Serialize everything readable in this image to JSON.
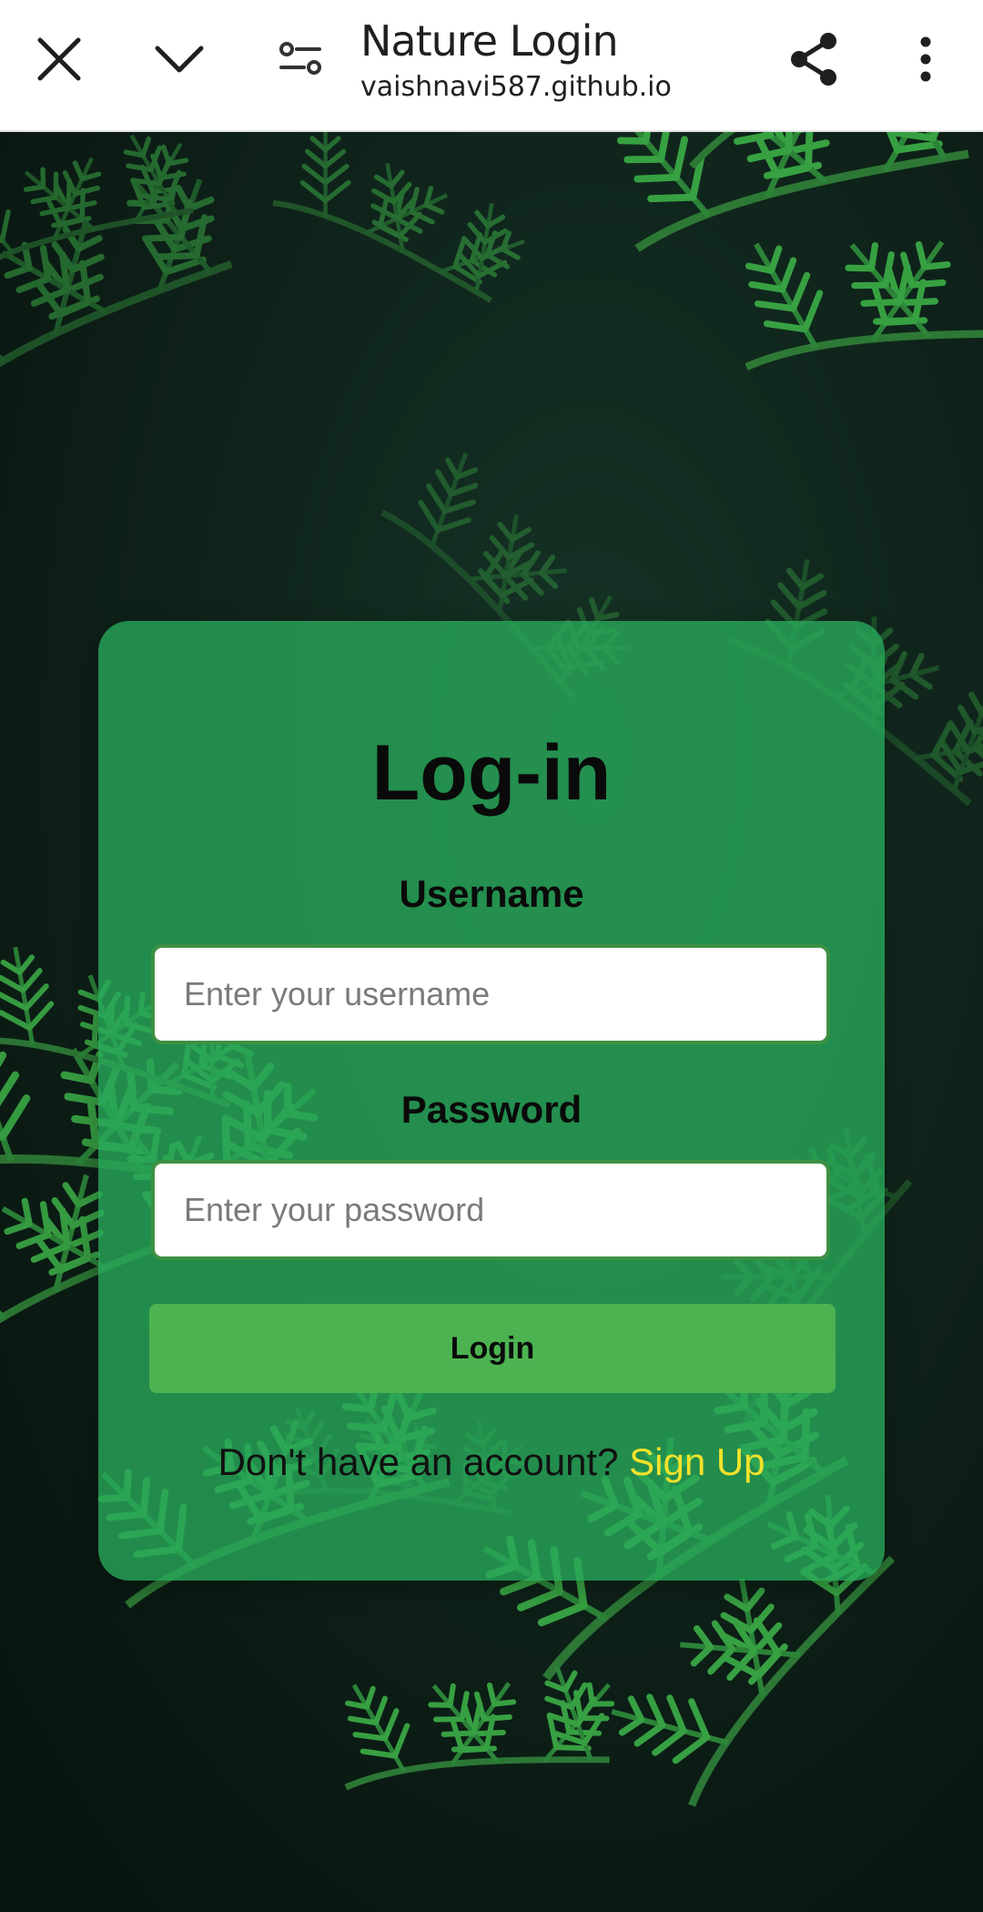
{
  "browser": {
    "title": "Nature Login",
    "url": "vaishnavi587.github.io",
    "icons": [
      "close-icon",
      "chevron-down-icon",
      "tune-icon",
      "share-icon",
      "more-vert-icon"
    ]
  },
  "login": {
    "title": "Log-in",
    "username_label": "Username",
    "username_placeholder": "Enter your username",
    "password_label": "Password",
    "password_placeholder": "Enter your password",
    "button_label": "Login",
    "signup_prompt": "Don't have an account?",
    "signup_link": "Sign Up"
  },
  "colors": {
    "card": "#28a85a",
    "button": "#4db351",
    "link": "#f2e22b",
    "background": "#0c1a14"
  }
}
